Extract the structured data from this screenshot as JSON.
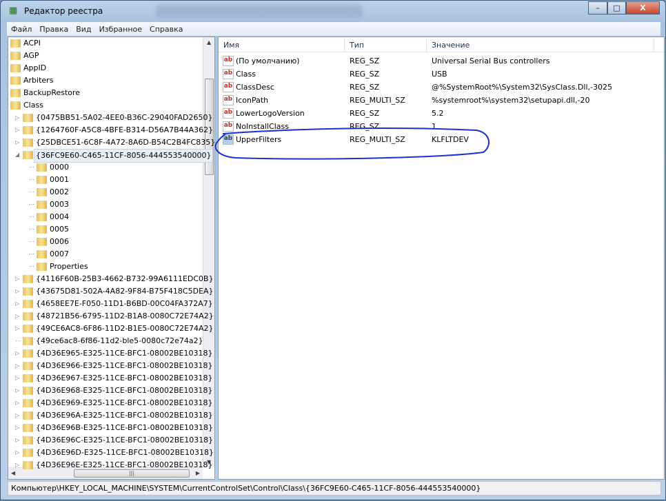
{
  "window": {
    "title": "Редактор реестра",
    "controls": {
      "minimize": "–",
      "maximize": "□",
      "close": "X"
    }
  },
  "menu": [
    "Файл",
    "Правка",
    "Вид",
    "Избранное",
    "Справка"
  ],
  "tree": {
    "root_items": [
      "ACPI",
      "AGP",
      "AppID",
      "Arbiters",
      "BackupRestore",
      "Class"
    ],
    "class_children_before": [
      "{0475BB51-5A02-4EE0-B36C-29040FAD2650}",
      "{1264760F-A5C8-4BFE-B314-D56A7B44A362}",
      "{25DBCE51-6C8F-4A72-8A6D-B54C2B4FC835}"
    ],
    "selected": "{36FC9E60-C465-11CF-8056-444553540000}",
    "selected_children": [
      "0000",
      "0001",
      "0002",
      "0003",
      "0004",
      "0005",
      "0006",
      "0007",
      "Properties"
    ],
    "class_children_after": [
      "{4116F60B-25B3-4662-B732-99A6111EDC0B}",
      "{43675D81-502A-4A82-9F84-B75F418C5DEA}",
      "{4658EE7E-F050-11D1-B6BD-00C04FA372A7}",
      "{48721B56-6795-11D2-B1A8-0080C72E74A2}",
      "{49CE6AC8-6F86-11D2-B1E5-0080C72E74A2}",
      "{49ce6ac8-6f86-11d2-ble5-0080c72e74a2}",
      "{4D36E965-E325-11CE-BFC1-08002BE10318}",
      "{4D36E966-E325-11CE-BFC1-08002BE10318}",
      "{4D36E967-E325-11CE-BFC1-08002BE10318}",
      "{4D36E968-E325-11CE-BFC1-08002BE10318}",
      "{4D36E969-E325-11CE-BFC1-08002BE10318}",
      "{4D36E96A-E325-11CE-BFC1-08002BE10318}",
      "{4D36E96B-E325-11CE-BFC1-08002BE10318}",
      "{4D36E96C-E325-11CE-BFC1-08002BE10318}",
      "{4D36E96D-E325-11CE-BFC1-08002BE10318}",
      "{4D36E96E-E325-11CE-BFC1-08002BE10318}"
    ],
    "no_toggle": [
      "{49ce6ac8-6f86-11d2-ble5-0080c72e74a2}"
    ]
  },
  "list": {
    "columns": {
      "name": "Имя",
      "type": "Тип",
      "value": "Значение"
    },
    "rows": [
      {
        "name": "(По умолчанию)",
        "type": "REG_SZ",
        "value": "Universal Serial Bus controllers",
        "icon": "string"
      },
      {
        "name": "Class",
        "type": "REG_SZ",
        "value": "USB",
        "icon": "string"
      },
      {
        "name": "ClassDesc",
        "type": "REG_SZ",
        "value": "@%SystemRoot%\\System32\\SysClass.Dll,-3025",
        "icon": "string"
      },
      {
        "name": "IconPath",
        "type": "REG_MULTI_SZ",
        "value": "%systemroot%\\system32\\setupapi.dll,-20",
        "icon": "string"
      },
      {
        "name": "LowerLogoVersion",
        "type": "REG_SZ",
        "value": "5.2",
        "icon": "string"
      },
      {
        "name": "NoInstallClass",
        "type": "REG_SZ",
        "value": "1",
        "icon": "string"
      },
      {
        "name": "UpperFilters",
        "type": "REG_MULTI_SZ",
        "value": "KLFLTDEV",
        "icon": "string-selected"
      }
    ],
    "annotation_color": "#1a2fd0"
  },
  "status": "Компьютер\\HKEY_LOCAL_MACHINE\\SYSTEM\\CurrentControlSet\\Control\\Class\\{36FC9E60-C465-11CF-8056-444553540000}"
}
